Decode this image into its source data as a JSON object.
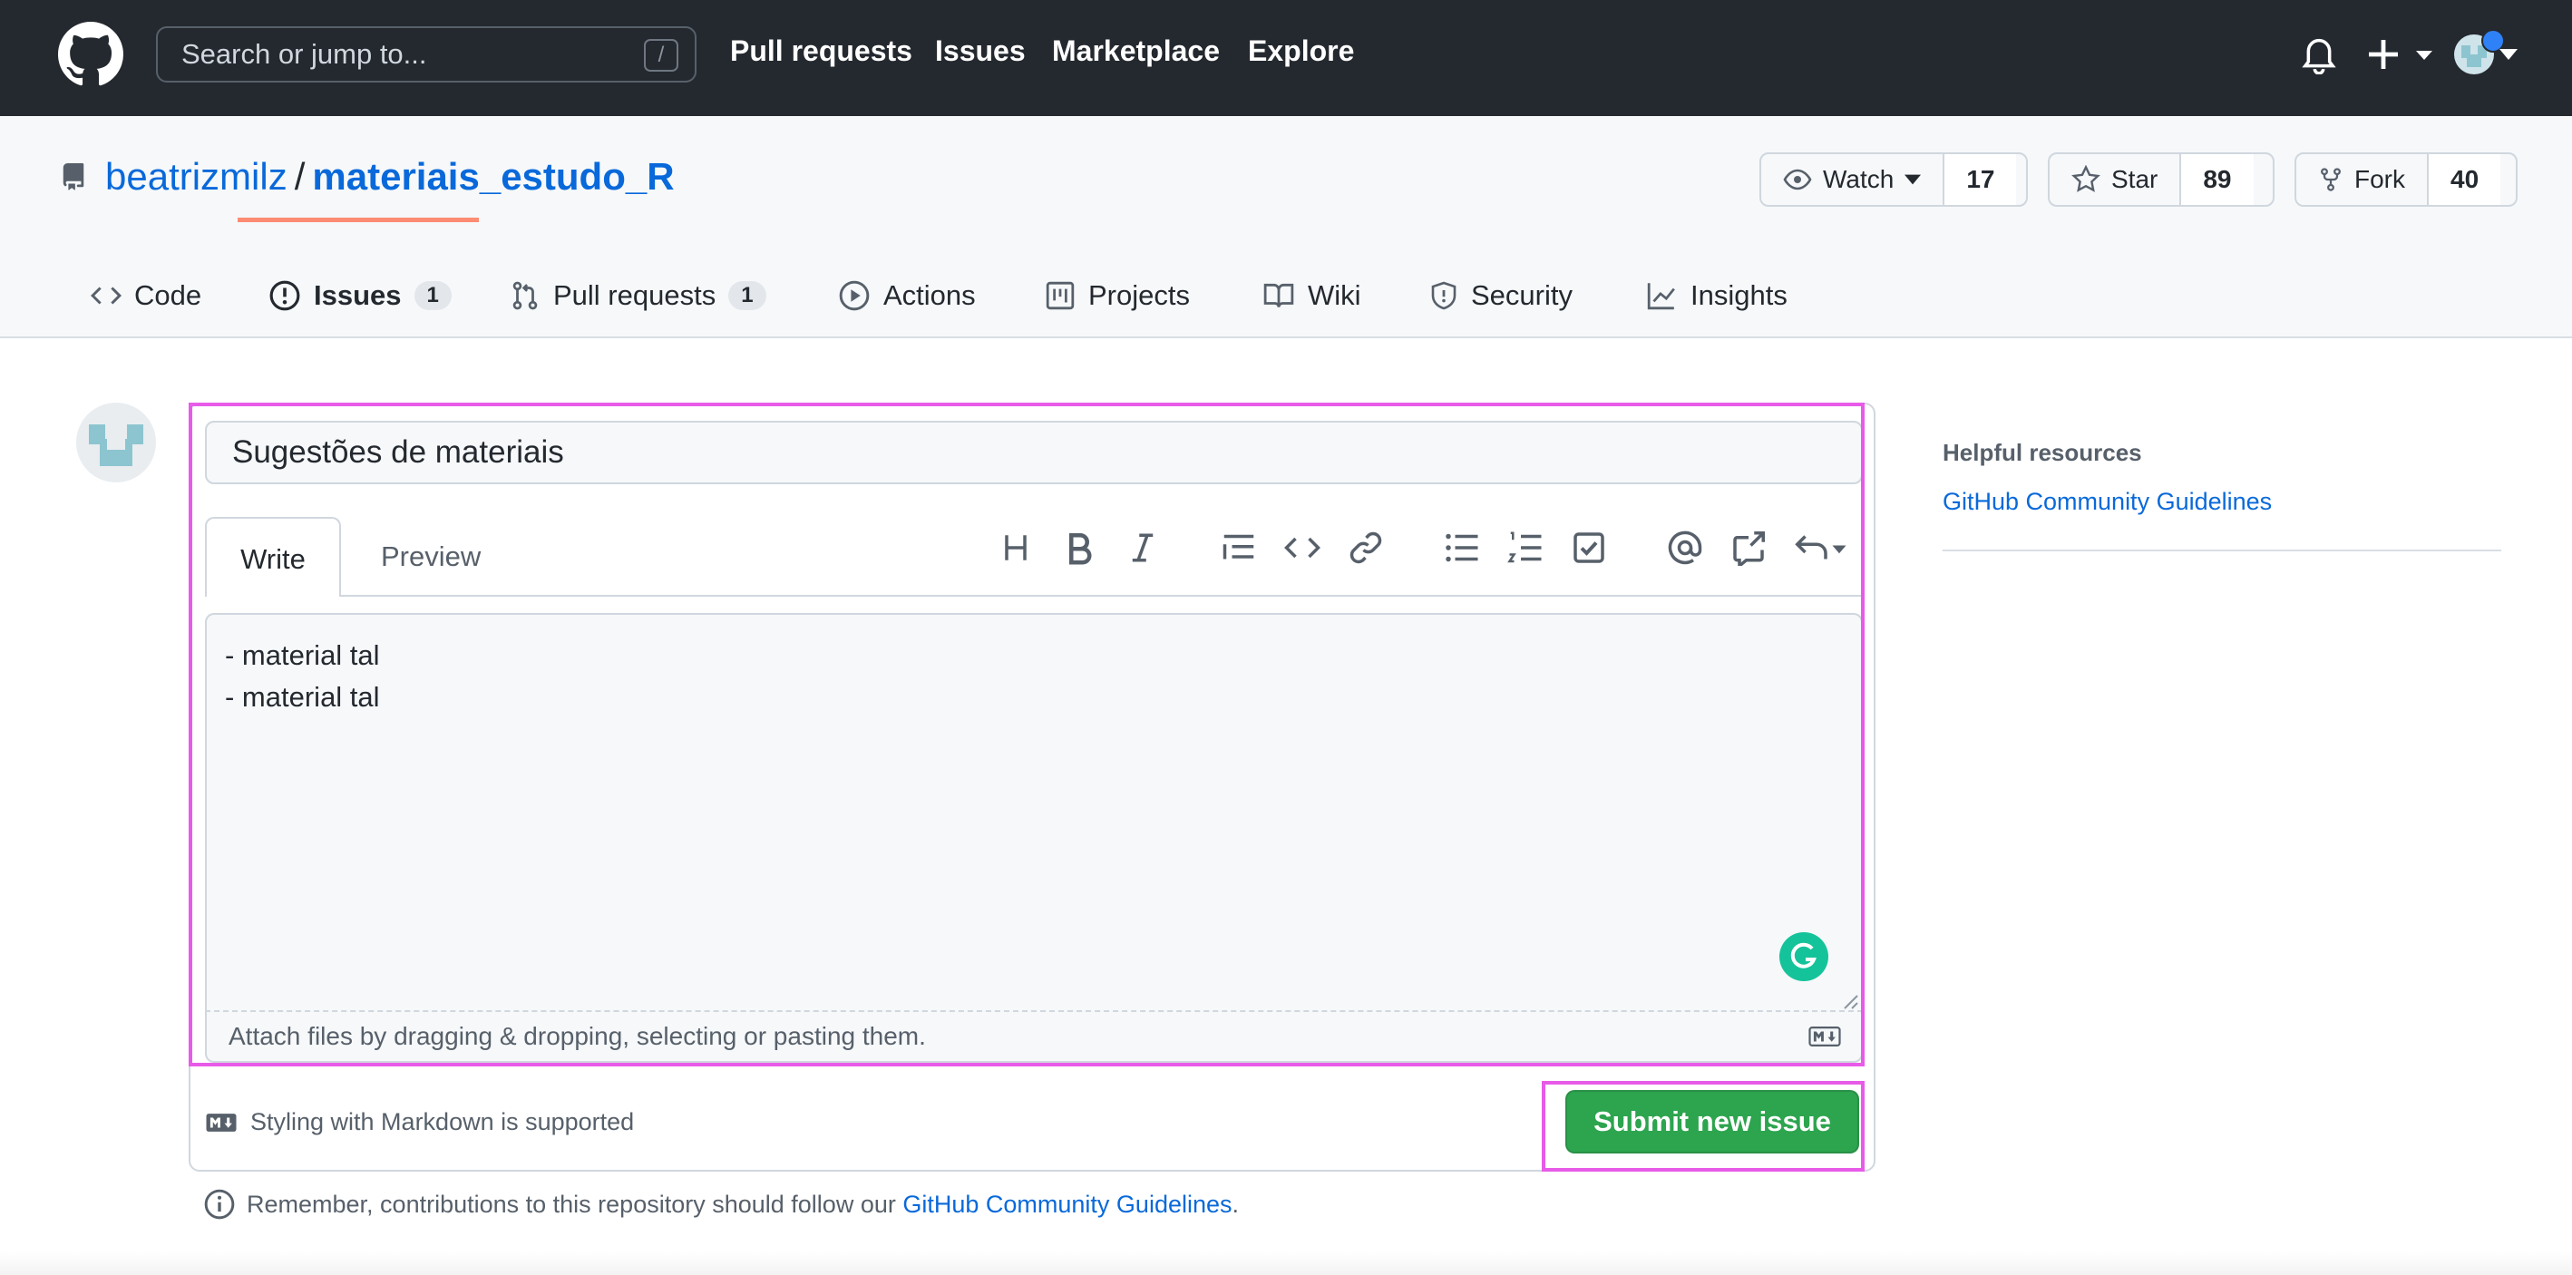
{
  "header": {
    "search_placeholder": "Search or jump to...",
    "search_shortcut": "/",
    "nav": [
      "Pull requests",
      "Issues",
      "Marketplace",
      "Explore"
    ]
  },
  "repo": {
    "owner": "beatrizmilz",
    "separator": "/",
    "name": "materiais_estudo_R",
    "watch_label": "Watch",
    "watch_count": "17",
    "star_label": "Star",
    "star_count": "89",
    "fork_label": "Fork",
    "fork_count": "40"
  },
  "tabs": {
    "code": "Code",
    "issues": "Issues",
    "issues_count": "1",
    "pulls": "Pull requests",
    "pulls_count": "1",
    "actions": "Actions",
    "projects": "Projects",
    "wiki": "Wiki",
    "security": "Security",
    "insights": "Insights"
  },
  "form": {
    "title_value": "Sugestões de materiais",
    "write_tab": "Write",
    "preview_tab": "Preview",
    "body_line_1": "- material tal",
    "body_line_2": "- material tal",
    "attach_text": "Attach files by dragging & dropping, selecting or pasting them.",
    "markdown_note": "Styling with Markdown is supported",
    "submit_label": "Submit new issue",
    "remember_prefix": "Remember, contributions to this repository should follow our ",
    "remember_link": "GitHub Community Guidelines",
    "remember_suffix": "."
  },
  "sidebar": {
    "heading": "Helpful resources",
    "link": "GitHub Community Guidelines"
  },
  "colors": {
    "header_bg": "#24292f",
    "link": "#0969da",
    "submit": "#2da44e",
    "selected_tab_underline": "#fd8c73",
    "highlight": "#e85be8"
  }
}
